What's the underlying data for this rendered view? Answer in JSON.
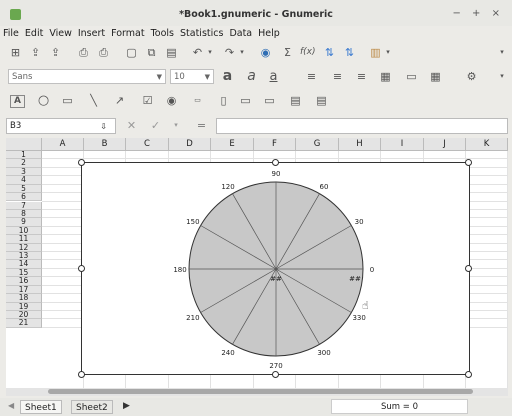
{
  "window": {
    "title": "*Book1.gnumeric - Gnumeric",
    "controls": "− + ×"
  },
  "menu": [
    "File",
    "Edit",
    "View",
    "Insert",
    "Format",
    "Tools",
    "Statistics",
    "Data",
    "Help"
  ],
  "format_bar": {
    "font_name": "Sans",
    "font_size": "10"
  },
  "edit_bar": {
    "cell_ref": "B3",
    "formula": ""
  },
  "columns": [
    "A",
    "B",
    "C",
    "D",
    "E",
    "F",
    "G",
    "H",
    "I",
    "J",
    "K"
  ],
  "rows": [
    "1",
    "2",
    "3",
    "4",
    "5",
    "6",
    "7",
    "8",
    "9",
    "10",
    "11",
    "12",
    "13",
    "14",
    "15",
    "16",
    "17",
    "18",
    "19",
    "20",
    "21"
  ],
  "chart_data": {
    "type": "polar",
    "angles": [
      "0",
      "30",
      "60",
      "90",
      "120",
      "150",
      "180",
      "210",
      "240",
      "270",
      "300",
      "330"
    ],
    "series_markers": [
      "##",
      "##"
    ],
    "fill": "#c8c8c8",
    "grid": true
  },
  "sheets": [
    "Sheet1",
    "Sheet2"
  ],
  "status": {
    "sum": "Sum = 0"
  }
}
